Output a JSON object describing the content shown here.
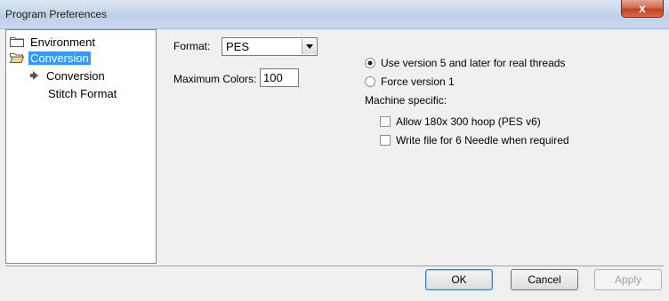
{
  "window": {
    "title": "Program Preferences",
    "close_label": "x"
  },
  "tree": {
    "items": [
      {
        "label": "Environment",
        "icon": "folder-closed-icon"
      },
      {
        "label": "Conversion",
        "icon": "folder-open-icon",
        "selected": true
      },
      {
        "label": "Conversion",
        "icon": "arrow-right-icon"
      },
      {
        "label": "Stitch Format"
      }
    ]
  },
  "settings": {
    "format_label": "Format:",
    "format_value": "PES",
    "max_colors_label": "Maximum Colors:",
    "max_colors_value": "100",
    "radio_v5_label": "Use version 5 and later for real threads",
    "radio_v5_checked": true,
    "radio_v1_label": "Force version 1",
    "radio_v1_checked": false,
    "machine_specific_label": "Machine specific:",
    "check_hoop_label": "Allow 180x 300 hoop (PES v6)",
    "check_hoop_checked": false,
    "check_needle_label": "Write file for 6 Needle when required",
    "check_needle_checked": false
  },
  "buttons": {
    "ok": "OK",
    "cancel": "Cancel",
    "apply": "Apply",
    "apply_enabled": false
  },
  "colors": {
    "selection": "#3399ff",
    "title_gradient_top": "#dbe6f3",
    "close_red": "#c3401f"
  }
}
